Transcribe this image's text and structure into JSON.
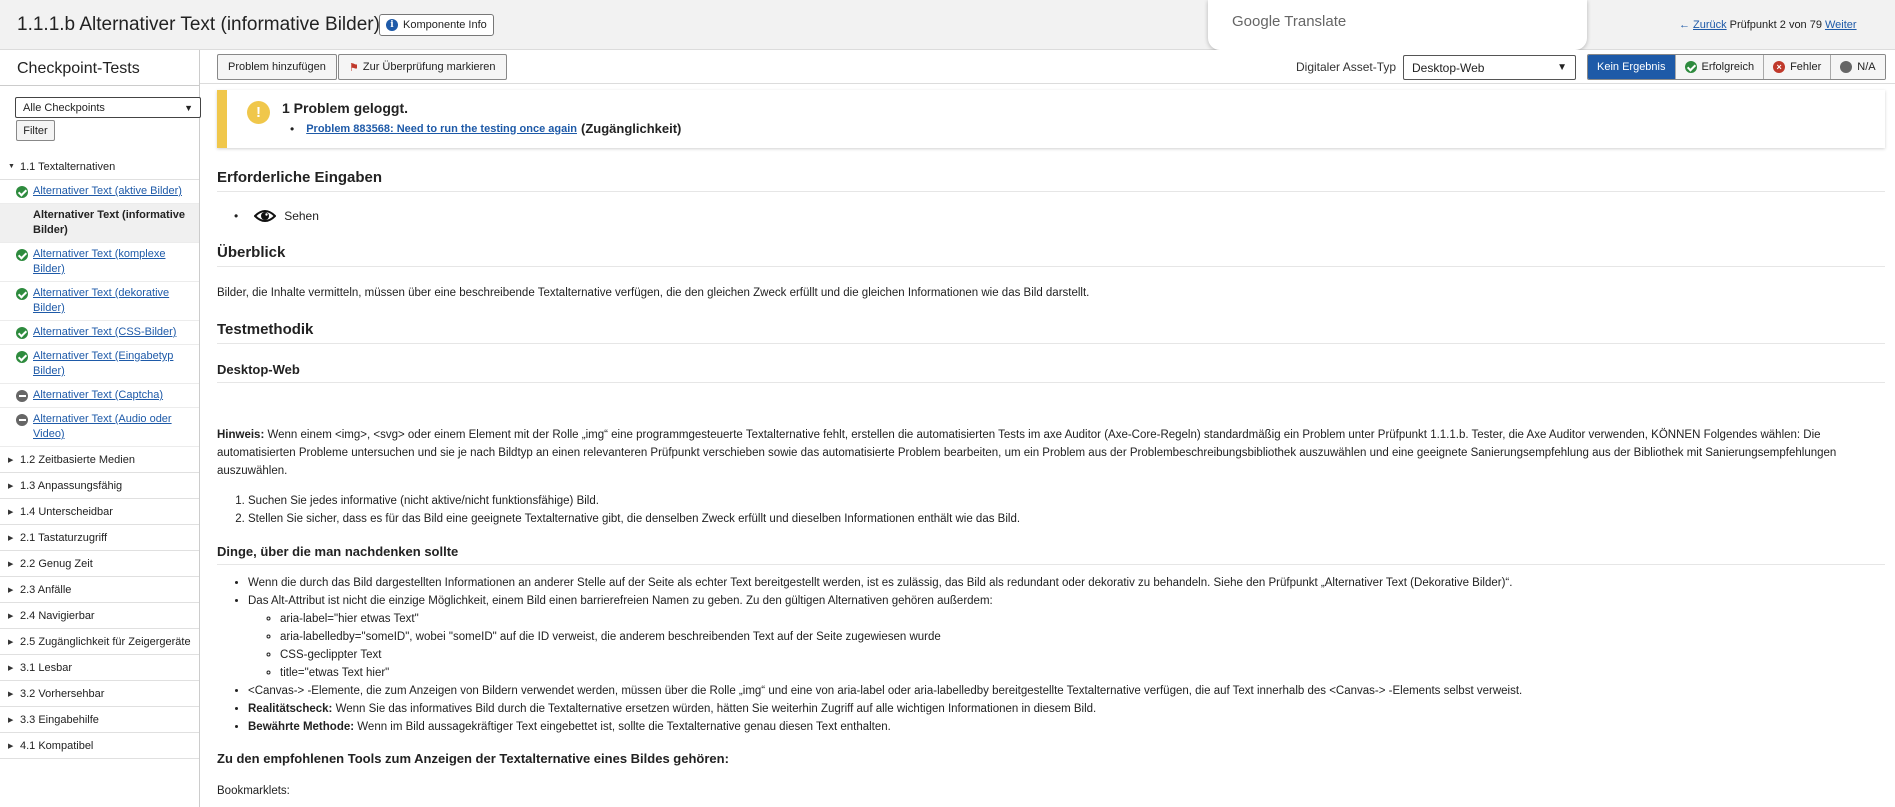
{
  "header": {
    "title": "1.1.1.b Alternativer Text (informative Bilder)",
    "component_info": "Komponente Info",
    "google_translate": "Google Translate",
    "back_label": "Zurück",
    "position": "Prüfpunkt 2 von 79",
    "next_label": "Weiter"
  },
  "sidebar": {
    "title": "Checkpoint-Tests",
    "filter_select": "Alle Checkpoints",
    "filter_button": "Filter",
    "expanded_group": "1.1 Textalternativen",
    "items": [
      {
        "label": "Alternativer Text (aktive Bilder)",
        "status": "pass"
      },
      {
        "label": "Alternativer Text (informative Bilder)",
        "status": "active"
      },
      {
        "label": "Alternativer Text (komplexe Bilder)",
        "status": "pass"
      },
      {
        "label": "Alternativer Text (dekorative Bilder)",
        "status": "pass"
      },
      {
        "label": "Alternativer Text (CSS-Bilder)",
        "status": "pass"
      },
      {
        "label": "Alternativer Text (Eingabetyp Bilder)",
        "status": "pass"
      },
      {
        "label": "Alternativer Text (Captcha)",
        "status": "na"
      },
      {
        "label": "Alternativer Text (Audio oder Video)",
        "status": "na"
      }
    ],
    "groups": [
      "1.2 Zeitbasierte Medien",
      "1.3 Anpassungsfähig",
      "1.4 Unterscheidbar",
      "2.1 Tastaturzugriff",
      "2.2 Genug Zeit",
      "2.3 Anfälle",
      "2.4 Navigierbar",
      "2.5 Zugänglichkeit für Zeigergeräte",
      "3.1 Lesbar",
      "3.2 Vorhersehbar",
      "3.3 Eingabehilfe",
      "4.1 Kompatibel"
    ]
  },
  "toolbar": {
    "add_problem": "Problem hinzufügen",
    "mark_review": "Zur Überprüfung markieren",
    "asset_label": "Digitaler Asset-Typ",
    "asset_value": "Desktop-Web",
    "results": {
      "none": "Kein Ergebnis",
      "pass": "Erfolgreich",
      "fail": "Fehler",
      "na": "N/A"
    }
  },
  "alert": {
    "title": "1 Problem geloggt.",
    "link": "Problem 883568: Need to run the testing once again",
    "category": "(Zugänglichkeit)"
  },
  "content": {
    "required_heading": "Erforderliche Eingaben",
    "required_item": "Sehen",
    "overview_heading": "Überblick",
    "overview_text": "Bilder, die Inhalte vermitteln, müssen über eine beschreibende Textalternative verfügen, die den gleichen Zweck erfüllt und die gleichen Informationen wie das Bild darstellt.",
    "method_heading": "Testmethodik",
    "platform_heading": "Desktop-Web",
    "note_label": "Hinweis:",
    "note_text": " Wenn einem <img>, <svg> oder einem Element mit der Rolle „img“ eine programmgesteuerte Textalternative fehlt, erstellen die automatisierten Tests im axe Auditor (Axe-Core-Regeln) standardmäßig ein Problem unter Prüfpunkt 1.1.1.b. Tester, die Axe Auditor verwenden, KÖNNEN Folgendes wählen: Die automatisierten Probleme untersuchen und sie je nach Bildtyp an einen relevanteren Prüfpunkt verschieben sowie das automatisierte Problem bearbeiten, um ein Problem aus der Problembeschreibungsbibliothek auszuwählen und eine geeignete Sanierungsempfehlung aus der Bibliothek mit Sanierungsempfehlungen auszuwählen.",
    "steps": [
      "Suchen Sie jedes informative (nicht aktive/nicht funktionsfähige) Bild.",
      "Stellen Sie sicher, dass es für das Bild eine geeignete Textalternative gibt, die denselben Zweck erfüllt und dieselben Informationen enthält wie das Bild."
    ],
    "think_heading": "Dinge, über die man nachdenken sollte",
    "think_1": "Wenn die durch das Bild dargestellten Informationen an anderer Stelle auf der Seite als echter Text bereitgestellt werden, ist es zulässig, das Bild als redundant oder dekorativ zu behandeln. Siehe den Prüfpunkt „Alternativer Text (Dekorative Bilder)“.",
    "think_2": "Das Alt-Attribut ist nicht die einzige Möglichkeit, einem Bild einen barrierefreien Namen zu geben. Zu den gültigen Alternativen gehören außerdem:",
    "think_2_sub": [
      "aria-label=\"hier etwas Text\"",
      "aria-labelledby=\"someID\", wobei \"someID\" auf die ID verweist, die anderem beschreibenden Text auf der Seite zugewiesen wurde",
      "CSS-geclippter Text",
      "title=\"etwas Text hier\""
    ],
    "think_3": "<Canvas-> -Elemente, die zum Anzeigen von Bildern verwendet werden, müssen über die Rolle „img“ und eine von aria-label oder aria-labelledby bereitgestellte Textalternative verfügen, die auf Text innerhalb des <Canvas-> -Elements selbst verweist.",
    "reality_label": "Realitätscheck:",
    "reality_text": " Wenn Sie das informatives Bild durch die Textalternative ersetzen würden, hätten Sie weiterhin Zugriff auf alle wichtigen Informationen in diesem Bild.",
    "best_label": "Bewährte Methode:",
    "best_text": " Wenn im Bild aussagekräftiger Text eingebettet ist, sollte die Textalternative genau diesen Text enthalten.",
    "tools_heading": "Zu den empfohlenen Tools zum Anzeigen der Textalternative eines Bildes gehören:",
    "bookmarklets": "Bookmarklets:"
  }
}
